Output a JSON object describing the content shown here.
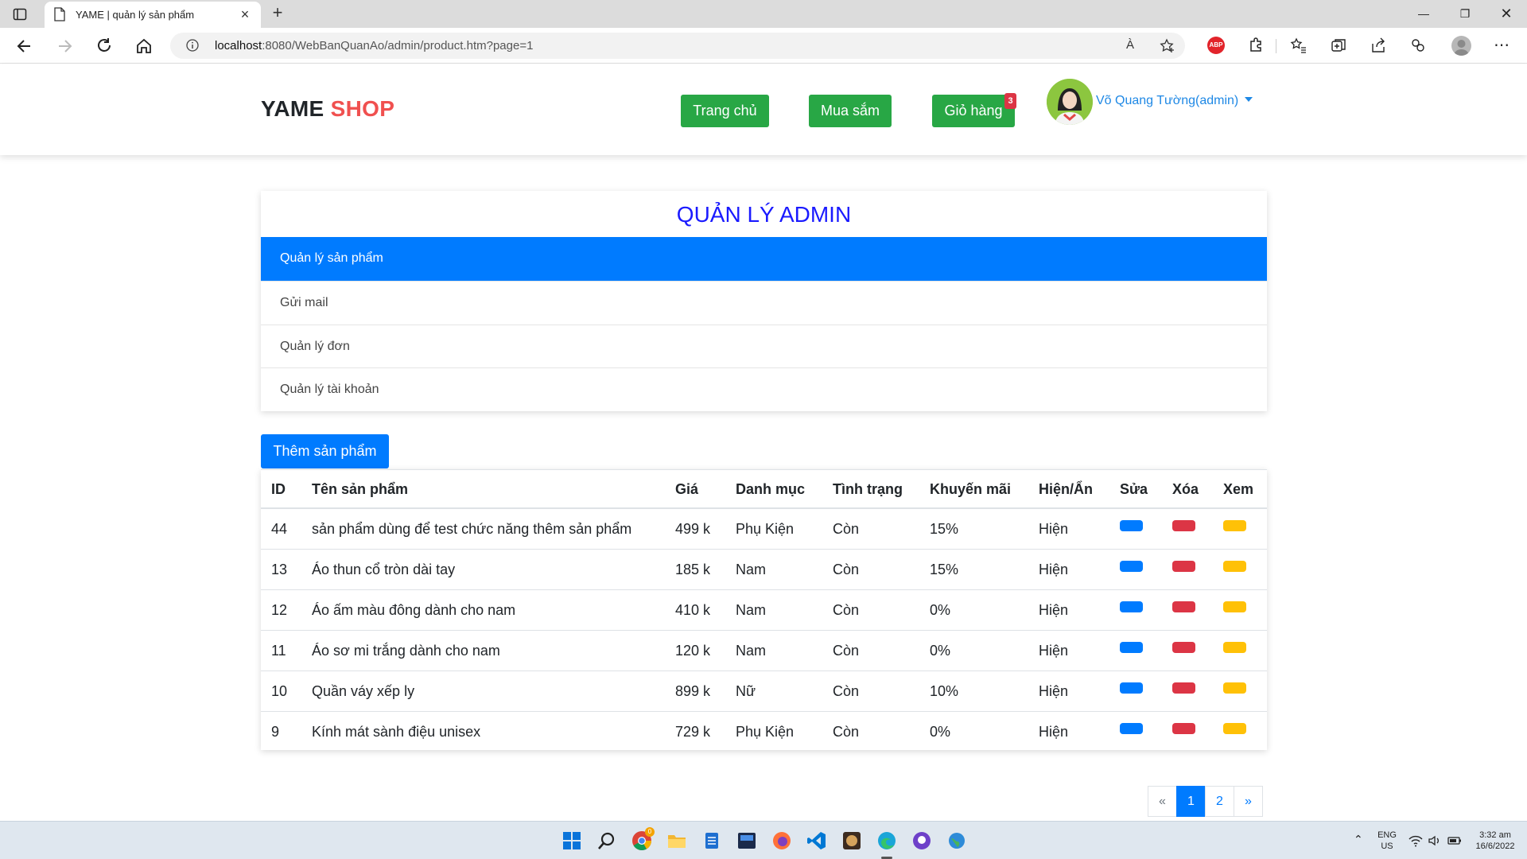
{
  "browser": {
    "tab_title": "YAME | quản lý sản phẩm",
    "url_host": "localhost",
    "url_rest": ":8080/WebBanQuanAo/admin/product.htm?page=1",
    "read_aloud_label": "À",
    "abp_label": "ABP"
  },
  "header": {
    "brand_main": "YAME",
    "brand_accent": "SHOP",
    "nav": [
      {
        "label": "Trang chủ"
      },
      {
        "label": "Mua sắm"
      },
      {
        "label": "Giỏ hàng"
      }
    ],
    "cart_count": "3",
    "user_name": "Võ Quang Tường(admin)"
  },
  "admin": {
    "title": "QUẢN LÝ ADMIN",
    "menu": [
      {
        "label": "Quản lý sản phẩm"
      },
      {
        "label": "Gửi mail"
      },
      {
        "label": "Quản lý đơn"
      },
      {
        "label": "Quản lý tài khoản"
      }
    ],
    "add_button": "Thêm sản phẩm"
  },
  "table": {
    "headers": [
      "ID",
      "Tên sản phẩm",
      "Giá",
      "Danh mục",
      "Tình trạng",
      "Khuyến mãi",
      "Hiện/Ẩn",
      "Sửa",
      "Xóa",
      "Xem"
    ],
    "rows": [
      {
        "id": "44",
        "name": "sản phẩm dùng để test chức năng thêm sản phẩm",
        "price": "499 k",
        "category": "Phụ Kiện",
        "status": "Còn",
        "discount": "15%",
        "visible": "Hiện"
      },
      {
        "id": "13",
        "name": "Áo thun cổ tròn dài tay",
        "price": "185 k",
        "category": "Nam",
        "status": "Còn",
        "discount": "15%",
        "visible": "Hiện"
      },
      {
        "id": "12",
        "name": "Áo ấm màu đông dành cho nam",
        "price": "410 k",
        "category": "Nam",
        "status": "Còn",
        "discount": "0%",
        "visible": "Hiện"
      },
      {
        "id": "11",
        "name": "Áo sơ mi trắng dành cho nam",
        "price": "120 k",
        "category": "Nam",
        "status": "Còn",
        "discount": "0%",
        "visible": "Hiện"
      },
      {
        "id": "10",
        "name": "Quần váy xếp ly",
        "price": "899 k",
        "category": "Nữ",
        "status": "Còn",
        "discount": "10%",
        "visible": "Hiện"
      },
      {
        "id": "9",
        "name": "Kính mát sành điệu unisex",
        "price": "729 k",
        "category": "Phụ Kiện",
        "status": "Còn",
        "discount": "0%",
        "visible": "Hiện"
      }
    ]
  },
  "pagination": {
    "prev": "«",
    "pages": [
      "1",
      "2"
    ],
    "current": "1",
    "next": "»"
  },
  "taskbar": {
    "language": "ENG",
    "region": "US",
    "time": "3:32 am",
    "date": "16/6/2022",
    "chrome_badge": "0"
  },
  "colors": {
    "primary": "#007bff",
    "success": "#28a745",
    "danger": "#dc3545",
    "warning": "#ffc107",
    "brand_accent": "#f0504f",
    "admin_title": "#1a1aff"
  }
}
